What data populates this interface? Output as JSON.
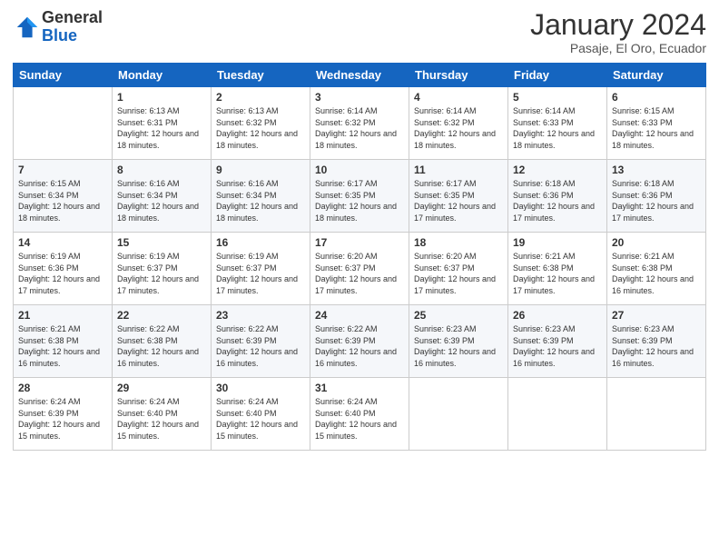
{
  "logo": {
    "general": "General",
    "blue": "Blue"
  },
  "header": {
    "month": "January 2024",
    "location": "Pasaje, El Oro, Ecuador"
  },
  "weekdays": [
    "Sunday",
    "Monday",
    "Tuesday",
    "Wednesday",
    "Thursday",
    "Friday",
    "Saturday"
  ],
  "weeks": [
    [
      {
        "day": "",
        "sunrise": "",
        "sunset": "",
        "daylight": ""
      },
      {
        "day": "1",
        "sunrise": "Sunrise: 6:13 AM",
        "sunset": "Sunset: 6:31 PM",
        "daylight": "Daylight: 12 hours and 18 minutes."
      },
      {
        "day": "2",
        "sunrise": "Sunrise: 6:13 AM",
        "sunset": "Sunset: 6:32 PM",
        "daylight": "Daylight: 12 hours and 18 minutes."
      },
      {
        "day": "3",
        "sunrise": "Sunrise: 6:14 AM",
        "sunset": "Sunset: 6:32 PM",
        "daylight": "Daylight: 12 hours and 18 minutes."
      },
      {
        "day": "4",
        "sunrise": "Sunrise: 6:14 AM",
        "sunset": "Sunset: 6:32 PM",
        "daylight": "Daylight: 12 hours and 18 minutes."
      },
      {
        "day": "5",
        "sunrise": "Sunrise: 6:14 AM",
        "sunset": "Sunset: 6:33 PM",
        "daylight": "Daylight: 12 hours and 18 minutes."
      },
      {
        "day": "6",
        "sunrise": "Sunrise: 6:15 AM",
        "sunset": "Sunset: 6:33 PM",
        "daylight": "Daylight: 12 hours and 18 minutes."
      }
    ],
    [
      {
        "day": "7",
        "sunrise": "Sunrise: 6:15 AM",
        "sunset": "Sunset: 6:34 PM",
        "daylight": "Daylight: 12 hours and 18 minutes."
      },
      {
        "day": "8",
        "sunrise": "Sunrise: 6:16 AM",
        "sunset": "Sunset: 6:34 PM",
        "daylight": "Daylight: 12 hours and 18 minutes."
      },
      {
        "day": "9",
        "sunrise": "Sunrise: 6:16 AM",
        "sunset": "Sunset: 6:34 PM",
        "daylight": "Daylight: 12 hours and 18 minutes."
      },
      {
        "day": "10",
        "sunrise": "Sunrise: 6:17 AM",
        "sunset": "Sunset: 6:35 PM",
        "daylight": "Daylight: 12 hours and 18 minutes."
      },
      {
        "day": "11",
        "sunrise": "Sunrise: 6:17 AM",
        "sunset": "Sunset: 6:35 PM",
        "daylight": "Daylight: 12 hours and 17 minutes."
      },
      {
        "day": "12",
        "sunrise": "Sunrise: 6:18 AM",
        "sunset": "Sunset: 6:36 PM",
        "daylight": "Daylight: 12 hours and 17 minutes."
      },
      {
        "day": "13",
        "sunrise": "Sunrise: 6:18 AM",
        "sunset": "Sunset: 6:36 PM",
        "daylight": "Daylight: 12 hours and 17 minutes."
      }
    ],
    [
      {
        "day": "14",
        "sunrise": "Sunrise: 6:19 AM",
        "sunset": "Sunset: 6:36 PM",
        "daylight": "Daylight: 12 hours and 17 minutes."
      },
      {
        "day": "15",
        "sunrise": "Sunrise: 6:19 AM",
        "sunset": "Sunset: 6:37 PM",
        "daylight": "Daylight: 12 hours and 17 minutes."
      },
      {
        "day": "16",
        "sunrise": "Sunrise: 6:19 AM",
        "sunset": "Sunset: 6:37 PM",
        "daylight": "Daylight: 12 hours and 17 minutes."
      },
      {
        "day": "17",
        "sunrise": "Sunrise: 6:20 AM",
        "sunset": "Sunset: 6:37 PM",
        "daylight": "Daylight: 12 hours and 17 minutes."
      },
      {
        "day": "18",
        "sunrise": "Sunrise: 6:20 AM",
        "sunset": "Sunset: 6:37 PM",
        "daylight": "Daylight: 12 hours and 17 minutes."
      },
      {
        "day": "19",
        "sunrise": "Sunrise: 6:21 AM",
        "sunset": "Sunset: 6:38 PM",
        "daylight": "Daylight: 12 hours and 17 minutes."
      },
      {
        "day": "20",
        "sunrise": "Sunrise: 6:21 AM",
        "sunset": "Sunset: 6:38 PM",
        "daylight": "Daylight: 12 hours and 16 minutes."
      }
    ],
    [
      {
        "day": "21",
        "sunrise": "Sunrise: 6:21 AM",
        "sunset": "Sunset: 6:38 PM",
        "daylight": "Daylight: 12 hours and 16 minutes."
      },
      {
        "day": "22",
        "sunrise": "Sunrise: 6:22 AM",
        "sunset": "Sunset: 6:38 PM",
        "daylight": "Daylight: 12 hours and 16 minutes."
      },
      {
        "day": "23",
        "sunrise": "Sunrise: 6:22 AM",
        "sunset": "Sunset: 6:39 PM",
        "daylight": "Daylight: 12 hours and 16 minutes."
      },
      {
        "day": "24",
        "sunrise": "Sunrise: 6:22 AM",
        "sunset": "Sunset: 6:39 PM",
        "daylight": "Daylight: 12 hours and 16 minutes."
      },
      {
        "day": "25",
        "sunrise": "Sunrise: 6:23 AM",
        "sunset": "Sunset: 6:39 PM",
        "daylight": "Daylight: 12 hours and 16 minutes."
      },
      {
        "day": "26",
        "sunrise": "Sunrise: 6:23 AM",
        "sunset": "Sunset: 6:39 PM",
        "daylight": "Daylight: 12 hours and 16 minutes."
      },
      {
        "day": "27",
        "sunrise": "Sunrise: 6:23 AM",
        "sunset": "Sunset: 6:39 PM",
        "daylight": "Daylight: 12 hours and 16 minutes."
      }
    ],
    [
      {
        "day": "28",
        "sunrise": "Sunrise: 6:24 AM",
        "sunset": "Sunset: 6:39 PM",
        "daylight": "Daylight: 12 hours and 15 minutes."
      },
      {
        "day": "29",
        "sunrise": "Sunrise: 6:24 AM",
        "sunset": "Sunset: 6:40 PM",
        "daylight": "Daylight: 12 hours and 15 minutes."
      },
      {
        "day": "30",
        "sunrise": "Sunrise: 6:24 AM",
        "sunset": "Sunset: 6:40 PM",
        "daylight": "Daylight: 12 hours and 15 minutes."
      },
      {
        "day": "31",
        "sunrise": "Sunrise: 6:24 AM",
        "sunset": "Sunset: 6:40 PM",
        "daylight": "Daylight: 12 hours and 15 minutes."
      },
      {
        "day": "",
        "sunrise": "",
        "sunset": "",
        "daylight": ""
      },
      {
        "day": "",
        "sunrise": "",
        "sunset": "",
        "daylight": ""
      },
      {
        "day": "",
        "sunrise": "",
        "sunset": "",
        "daylight": ""
      }
    ]
  ]
}
